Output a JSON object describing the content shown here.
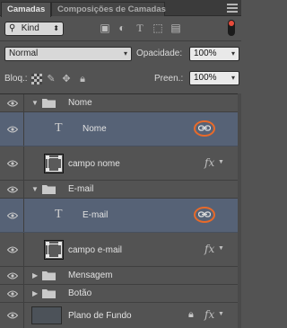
{
  "tabs": [
    {
      "label": "Camadas",
      "active": true
    },
    {
      "label": "Composições de Camadas",
      "active": false
    }
  ],
  "filter": {
    "kind_label": "Kind",
    "icons": [
      "image-filter-icon",
      "adjustment-filter-icon",
      "type-filter-icon",
      "shape-filter-icon",
      "smart-object-filter-icon"
    ]
  },
  "blend": {
    "mode": "Normal",
    "opacity_label": "Opacidade:",
    "opacity_value": "100%"
  },
  "lock": {
    "label": "Bloq.:",
    "fill_label": "Preen.:",
    "fill_value": "100%"
  },
  "layers": [
    {
      "name": "Nome",
      "kind": "group",
      "expanded": true
    },
    {
      "name": "Nome",
      "kind": "text",
      "selected": true,
      "linked": true
    },
    {
      "name": "campo nome",
      "kind": "shape",
      "fx": true
    },
    {
      "name": "E-mail",
      "kind": "group",
      "expanded": true
    },
    {
      "name": "E-mail",
      "kind": "text",
      "selected": true,
      "linked": true
    },
    {
      "name": "campo e-mail",
      "kind": "shape",
      "fx": true
    },
    {
      "name": "Mensagem",
      "kind": "group",
      "expanded": false
    },
    {
      "name": "Botão",
      "kind": "group",
      "expanded": false
    },
    {
      "name": "Plano de Fundo",
      "kind": "background",
      "locked": true,
      "fx": true
    }
  ],
  "colors": {
    "selected_row": "#566276",
    "highlight_ring": "#e86a2a",
    "filter_toggle": "#e84b3b"
  }
}
